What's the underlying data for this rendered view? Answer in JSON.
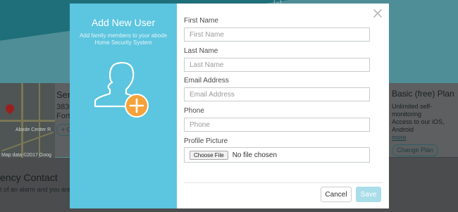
{
  "background": {
    "top_icon": "[⌂]",
    "map": {
      "credit": "Map data ©2017 Goog",
      "label": "Abode Center R"
    },
    "service": {
      "title": "Servi",
      "line1": "3830",
      "line2": "Fort W",
      "pill": "+ C"
    },
    "plan": {
      "title": "Basic (free) Plan",
      "line1": "Unlimited self-monitoring",
      "line2": "Access to our iOS, Android",
      "more": "more",
      "button": "Change Plan"
    },
    "emergency": {
      "heading": "ency Contact",
      "text": "t of an alarm and you are p"
    }
  },
  "modal": {
    "title": "Add New User",
    "subtitle": "Add family members to your abode Home Security System",
    "fields": {
      "first_name": {
        "label": "First Name",
        "placeholder": "First Name",
        "value": ""
      },
      "last_name": {
        "label": "Last Name",
        "placeholder": "Last Name",
        "value": ""
      },
      "email": {
        "label": "Email Address",
        "placeholder": "Email Address",
        "value": ""
      },
      "phone": {
        "label": "Phone",
        "placeholder": "Phone",
        "value": ""
      },
      "picture": {
        "label": "Profile Picture",
        "button": "Choose File",
        "status": "No file chosen"
      }
    },
    "actions": {
      "cancel": "Cancel",
      "save": "Save"
    }
  },
  "colors": {
    "accent": "#5cc5df",
    "avatar_badge": "#f5a23a",
    "save_disabled": "#a9dde9"
  }
}
